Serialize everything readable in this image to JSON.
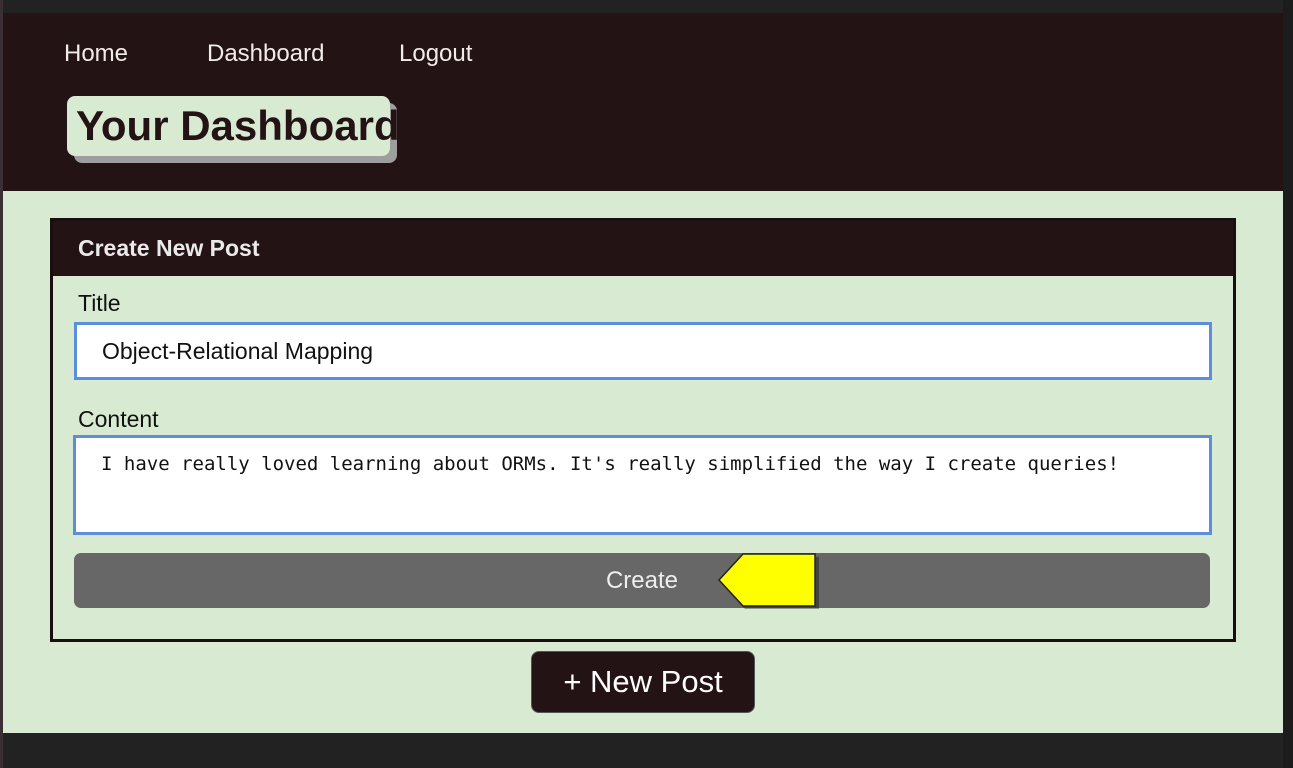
{
  "nav": {
    "home": "Home",
    "dashboard": "Dashboard",
    "logout": "Logout"
  },
  "page": {
    "title": "Your Dashboard"
  },
  "create_post": {
    "heading": "Create New Post",
    "title_label": "Title",
    "title_value": "Object-Relational Mapping",
    "content_label": "Content",
    "content_value": "I have really loved learning about ORMs. It's really simplified the way I create queries!",
    "create_button": "Create"
  },
  "new_post_button": "+ New Post",
  "colors": {
    "header_bg": "#231314",
    "main_bg": "#d9ead3",
    "input_border": "#5b8fdc",
    "button_gray": "#676767",
    "annotation_arrow": "#ffff00"
  },
  "icons": {
    "annotation": "yellow-arrow-pointer"
  }
}
